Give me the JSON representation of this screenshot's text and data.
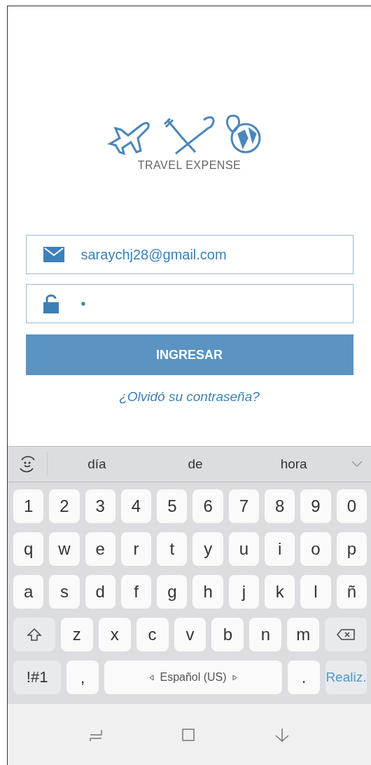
{
  "logo": {
    "title": "TRAVEL EXPENSE"
  },
  "login": {
    "email": {
      "value": "saraychj28@gmail.com"
    },
    "password": {
      "value": "•"
    },
    "submit": "INGRESAR",
    "forgot": "¿Olvidó su contraseña?"
  },
  "keyboard": {
    "suggestions": [
      "día",
      "de",
      "hora"
    ],
    "rows": [
      {
        "keys": [
          {
            "kind": "char",
            "label": "1"
          },
          {
            "kind": "char",
            "label": "2"
          },
          {
            "kind": "char",
            "label": "3"
          },
          {
            "kind": "char",
            "label": "4"
          },
          {
            "kind": "char",
            "label": "5"
          },
          {
            "kind": "char",
            "label": "6"
          },
          {
            "kind": "char",
            "label": "7"
          },
          {
            "kind": "char",
            "label": "8"
          },
          {
            "kind": "char",
            "label": "9"
          },
          {
            "kind": "char",
            "label": "0"
          }
        ]
      },
      {
        "keys": [
          {
            "kind": "char",
            "label": "q"
          },
          {
            "kind": "char",
            "label": "w"
          },
          {
            "kind": "char",
            "label": "e"
          },
          {
            "kind": "char",
            "label": "r"
          },
          {
            "kind": "char",
            "label": "t"
          },
          {
            "kind": "char",
            "label": "y"
          },
          {
            "kind": "char",
            "label": "u"
          },
          {
            "kind": "char",
            "label": "i"
          },
          {
            "kind": "char",
            "label": "o"
          },
          {
            "kind": "char",
            "label": "p"
          }
        ]
      },
      {
        "keys": [
          {
            "kind": "char",
            "label": "a"
          },
          {
            "kind": "char",
            "label": "s"
          },
          {
            "kind": "char",
            "label": "d"
          },
          {
            "kind": "char",
            "label": "f"
          },
          {
            "kind": "char",
            "label": "g"
          },
          {
            "kind": "char",
            "label": "h"
          },
          {
            "kind": "char",
            "label": "j"
          },
          {
            "kind": "char",
            "label": "k"
          },
          {
            "kind": "char",
            "label": "l"
          },
          {
            "kind": "char",
            "label": "ñ"
          }
        ]
      },
      {
        "keys": [
          {
            "kind": "shift"
          },
          {
            "kind": "char",
            "label": "z"
          },
          {
            "kind": "char",
            "label": "x"
          },
          {
            "kind": "char",
            "label": "c"
          },
          {
            "kind": "char",
            "label": "v"
          },
          {
            "kind": "char",
            "label": "b"
          },
          {
            "kind": "char",
            "label": "n"
          },
          {
            "kind": "char",
            "label": "m"
          },
          {
            "kind": "backspace"
          }
        ]
      },
      {
        "keys": [
          {
            "kind": "symbols",
            "label": "!#1"
          },
          {
            "kind": "char",
            "label": ","
          },
          {
            "kind": "space",
            "label": "Español (US)"
          },
          {
            "kind": "char",
            "label": "."
          },
          {
            "kind": "action",
            "label": "Realiz."
          }
        ]
      }
    ]
  }
}
